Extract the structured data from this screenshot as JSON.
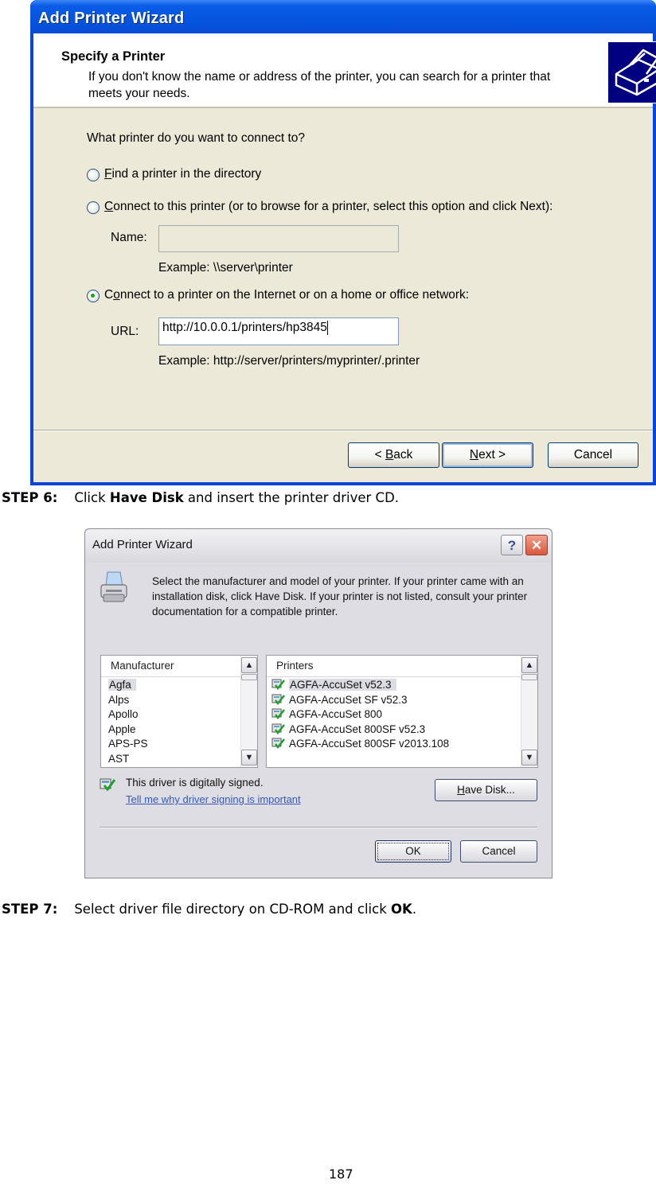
{
  "dialog1": {
    "window_title": "Add Printer Wizard",
    "header_title": "Specify a Printer",
    "header_subtitle": "If you don't know the name or address of the printer, you can search for a printer that meets your needs.",
    "header_icon": "printer-icon",
    "question": "What printer do you want to connect to?",
    "options": [
      {
        "label": "Find a printer in the directory",
        "mnemonic": "F",
        "rest": "ind a printer in the directory",
        "selected": false
      },
      {
        "label": "Connect to this printer (or to browse for a printer, select this option and click Next):",
        "mnemonic": "C",
        "rest": "onnect to this printer (or to browse for a printer, select this option and click Next):",
        "selected": false
      },
      {
        "label": "Connect to a printer on the Internet or on a home or office network:",
        "pre": "C",
        "mnemonic": "o",
        "rest": "nnect to a printer on the Internet or on a home or office network:",
        "selected": true
      }
    ],
    "name_field": {
      "label": "Name:",
      "value": "",
      "example": "Example: \\\\server\\printer",
      "disabled": true
    },
    "url_field": {
      "label": "URL:",
      "value": "http://10.0.0.1/printers/hp3845",
      "example": "Example: http://server/printers/myprinter/.printer"
    },
    "buttons": {
      "back": {
        "prefix": "< ",
        "mnemonic": "B",
        "rest": "ack"
      },
      "next": {
        "mnemonic": "N",
        "rest": "ext >"
      },
      "cancel": "Cancel"
    }
  },
  "step6": {
    "label": "STEP 6:",
    "pre": "Click ",
    "bold": "Have Disk",
    "post": " and insert the printer driver CD."
  },
  "dialog2": {
    "window_title": "Add Printer Wizard",
    "help_glyph": "?",
    "close_glyph": "✕",
    "description": "Select the manufacturer and model of your printer. If your printer came with an installation disk, click Have Disk. If your printer is not listed, consult your printer documentation for a compatible printer.",
    "manufacturer_header": "Manufacturer",
    "manufacturers": [
      "Agfa",
      "Alps",
      "Apollo",
      "Apple",
      "APS-PS",
      "AST"
    ],
    "selected_manufacturer": "Agfa",
    "printers_header": "Printers",
    "printers": [
      "AGFA-AccuSet v52.3",
      "AGFA-AccuSet SF v52.3",
      "AGFA-AccuSet 800",
      "AGFA-AccuSet 800SF v52.3",
      "AGFA-AccuSet 800SF v2013.108"
    ],
    "selected_printer": "AGFA-AccuSet v52.3",
    "signed_text": "This driver is digitally signed.",
    "signing_link": "Tell me why driver signing is important",
    "have_disk": {
      "mnemonic": "H",
      "rest": "ave Disk..."
    },
    "ok": "OK",
    "cancel": "Cancel"
  },
  "step7": {
    "label": "STEP 7:",
    "pre": "Select driver file directory on CD-ROM and click ",
    "bold": "OK",
    "post": "."
  },
  "page_number": "187"
}
